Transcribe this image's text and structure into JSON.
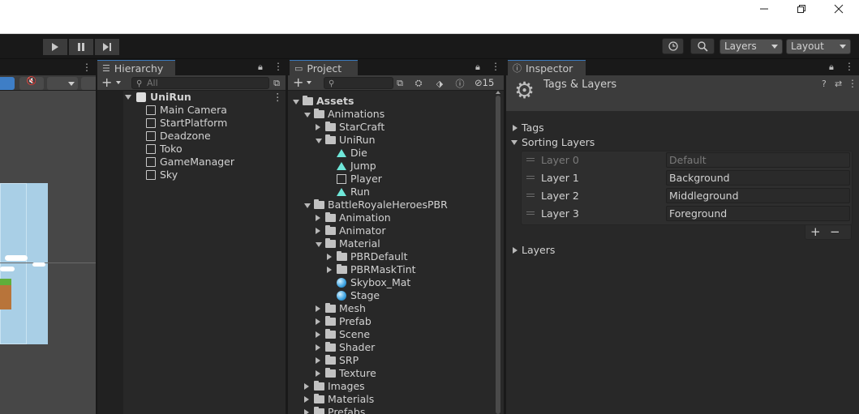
{
  "window": {
    "controls": [
      "minimize",
      "restore",
      "close"
    ]
  },
  "toolbar": {
    "layers_dropdown": "Layers",
    "layout_dropdown": "Layout"
  },
  "hierarchy": {
    "tab_label": "Hierarchy",
    "search_placeholder": "All",
    "scene_name": "UniRun",
    "items": [
      "Main Camera",
      "StartPlatform",
      "Deadzone",
      "Toko",
      "GameManager",
      "Sky"
    ]
  },
  "project": {
    "tab_label": "Project",
    "hidden_count": "15",
    "tree": [
      {
        "label": "Assets",
        "indent": 0,
        "expand": "down",
        "icon": "folder-open",
        "bold": true
      },
      {
        "label": "Animations",
        "indent": 1,
        "expand": "down",
        "icon": "folder-open"
      },
      {
        "label": "StarCraft",
        "indent": 2,
        "expand": "right",
        "icon": "folder"
      },
      {
        "label": "UniRun",
        "indent": 2,
        "expand": "down",
        "icon": "folder-open"
      },
      {
        "label": "Die",
        "indent": 3,
        "expand": "none",
        "icon": "animation-clip"
      },
      {
        "label": "Jump",
        "indent": 3,
        "expand": "none",
        "icon": "animation-clip"
      },
      {
        "label": "Player",
        "indent": 3,
        "expand": "none",
        "icon": "animator-controller"
      },
      {
        "label": "Run",
        "indent": 3,
        "expand": "none",
        "icon": "animation-clip"
      },
      {
        "label": "BattleRoyaleHeroesPBR",
        "indent": 1,
        "expand": "down",
        "icon": "folder-open"
      },
      {
        "label": "Animation",
        "indent": 2,
        "expand": "right",
        "icon": "folder"
      },
      {
        "label": "Animator",
        "indent": 2,
        "expand": "right",
        "icon": "folder"
      },
      {
        "label": "Material",
        "indent": 2,
        "expand": "down",
        "icon": "folder-open"
      },
      {
        "label": "PBRDefault",
        "indent": 3,
        "expand": "right",
        "icon": "folder"
      },
      {
        "label": "PBRMaskTint",
        "indent": 3,
        "expand": "right",
        "icon": "folder"
      },
      {
        "label": "Skybox_Mat",
        "indent": 3,
        "expand": "none",
        "icon": "material"
      },
      {
        "label": "Stage",
        "indent": 3,
        "expand": "none",
        "icon": "material"
      },
      {
        "label": "Mesh",
        "indent": 2,
        "expand": "right",
        "icon": "folder"
      },
      {
        "label": "Prefab",
        "indent": 2,
        "expand": "right",
        "icon": "folder"
      },
      {
        "label": "Scene",
        "indent": 2,
        "expand": "right",
        "icon": "folder"
      },
      {
        "label": "Shader",
        "indent": 2,
        "expand": "right",
        "icon": "folder"
      },
      {
        "label": "SRP",
        "indent": 2,
        "expand": "right",
        "icon": "folder"
      },
      {
        "label": "Texture",
        "indent": 2,
        "expand": "right",
        "icon": "folder"
      },
      {
        "label": "Images",
        "indent": 1,
        "expand": "right",
        "icon": "folder"
      },
      {
        "label": "Materials",
        "indent": 1,
        "expand": "right",
        "icon": "folder"
      },
      {
        "label": "Prefabs",
        "indent": 1,
        "expand": "right",
        "icon": "folder"
      }
    ]
  },
  "inspector": {
    "tab_label": "Inspector",
    "title": "Tags & Layers",
    "tags_label": "Tags",
    "sorting_layers_label": "Sorting Layers",
    "layers_label": "Layers",
    "sorting_layers": [
      {
        "name": "Layer 0",
        "value": "Default",
        "disabled": true
      },
      {
        "name": "Layer 1",
        "value": "Background",
        "disabled": false
      },
      {
        "name": "Layer 2",
        "value": "Middleground",
        "disabled": false
      },
      {
        "name": "Layer 3",
        "value": "Foreground",
        "disabled": false
      }
    ],
    "add_symbol": "+",
    "remove_symbol": "−"
  }
}
